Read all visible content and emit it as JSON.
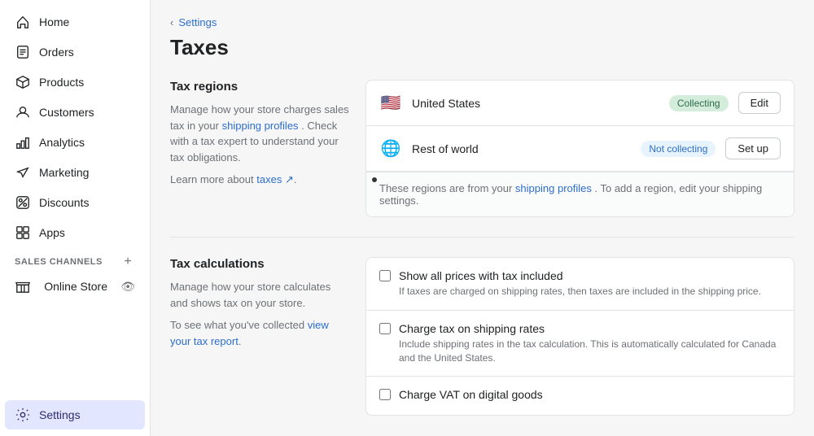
{
  "sidebar": {
    "items": [
      {
        "id": "home",
        "label": "Home",
        "icon": "home"
      },
      {
        "id": "orders",
        "label": "Orders",
        "icon": "orders"
      },
      {
        "id": "products",
        "label": "Products",
        "icon": "products"
      },
      {
        "id": "customers",
        "label": "Customers",
        "icon": "customers"
      },
      {
        "id": "analytics",
        "label": "Analytics",
        "icon": "analytics"
      },
      {
        "id": "marketing",
        "label": "Marketing",
        "icon": "marketing"
      },
      {
        "id": "discounts",
        "label": "Discounts",
        "icon": "discounts"
      },
      {
        "id": "apps",
        "label": "Apps",
        "icon": "apps"
      }
    ],
    "channels_label": "SALES CHANNELS",
    "online_store_label": "Online Store",
    "settings_label": "Settings"
  },
  "header": {
    "breadcrumb": "Settings",
    "title": "Taxes"
  },
  "tax_regions": {
    "section_title": "Tax regions",
    "description1": "Manage how your store charges sales tax in your",
    "shipping_profiles_link1": "shipping profiles",
    "description2": ". Check with a tax expert to understand your tax obligations.",
    "learn_more": "Learn more about",
    "taxes_link": "taxes",
    "regions": [
      {
        "flag": "🇺🇸",
        "name": "United States",
        "badge": "Collecting",
        "badge_type": "collecting",
        "button": "Edit"
      },
      {
        "flag": "🌐",
        "name": "Rest of world",
        "badge": "Not collecting",
        "badge_type": "not-collecting",
        "button": "Set up"
      }
    ],
    "footer_text1": "These regions are from your",
    "footer_link": "shipping profiles",
    "footer_text2": ". To add a region, edit your shipping settings."
  },
  "tax_calculations": {
    "section_title": "Tax calculations",
    "description1": "Manage how your store calculates and shows tax on your store.",
    "description2": "To see what you've collected",
    "view_report_link": "view your tax report",
    "checkboxes": [
      {
        "id": "show-prices",
        "label": "Show all prices with tax included",
        "description": "If taxes are charged on shipping rates, then taxes are included in the shipping price."
      },
      {
        "id": "charge-shipping",
        "label": "Charge tax on shipping rates",
        "description": "Include shipping rates in the tax calculation. This is automatically calculated for Canada and the United States."
      },
      {
        "id": "charge-vat",
        "label": "Charge VAT on digital goods",
        "description": ""
      }
    ]
  }
}
